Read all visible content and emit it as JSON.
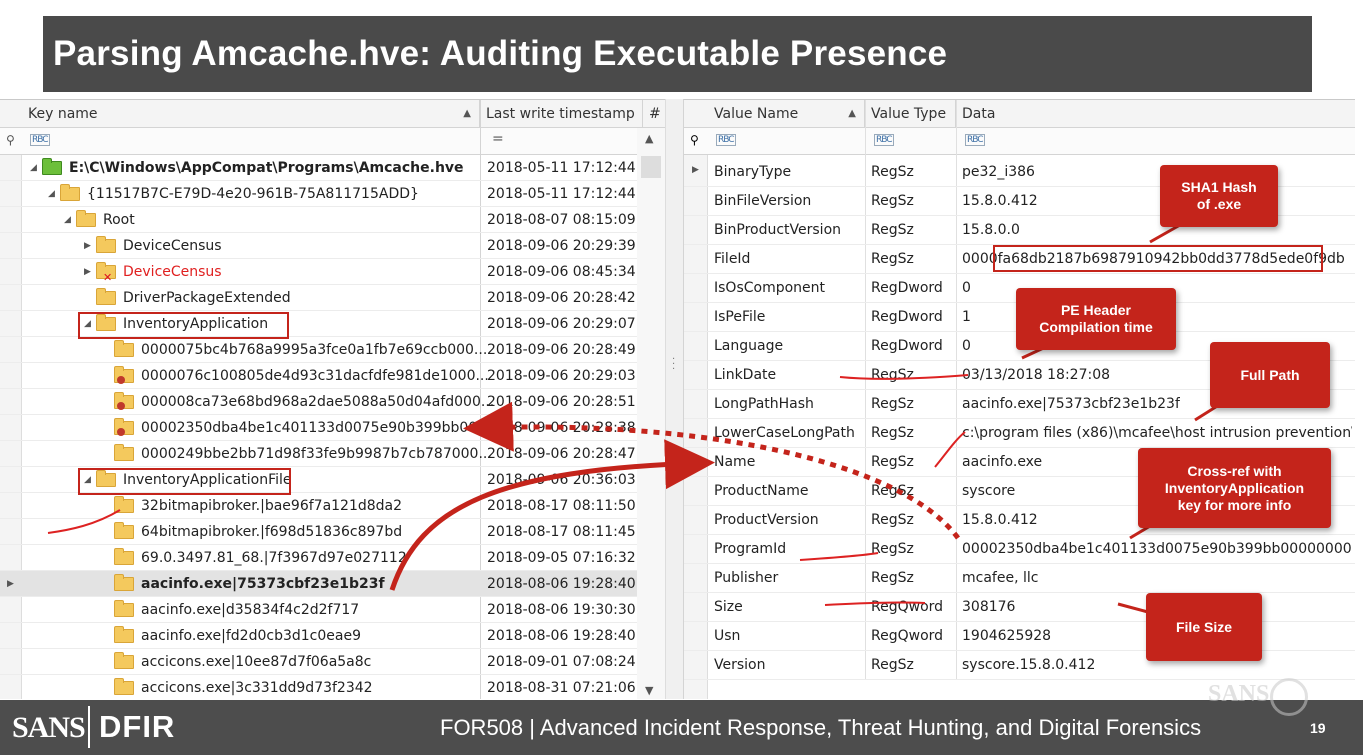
{
  "title": "Parsing Amcache.hve: Auditing Executable Presence",
  "left_pane": {
    "headers": {
      "key_name": "Key name",
      "last_write": "Last write timestamp",
      "hash_col": "#"
    },
    "filter": {
      "key_name": "RBC",
      "last_write": "="
    },
    "rows": [
      {
        "name": "E:\\C\\Windows\\AppCompat\\Programs\\Amcache.hve",
        "ts": "2018-05-11 17:12:44"
      },
      {
        "name": "{11517B7C-E79D-4e20-961B-75A811715ADD}",
        "ts": "2018-05-11 17:12:44"
      },
      {
        "name": "Root",
        "ts": "2018-08-07 08:15:09"
      },
      {
        "name": "DeviceCensus",
        "ts": "2018-09-06 20:29:39"
      },
      {
        "name": "DeviceCensus",
        "ts": "2018-09-06 08:45:34"
      },
      {
        "name": "DriverPackageExtended",
        "ts": "2018-09-06 20:28:42"
      },
      {
        "name": "InventoryApplication",
        "ts": "2018-09-06 20:29:07"
      },
      {
        "name": "0000075bc4b768a9995a3fce0a1fb7e69ccb000...",
        "ts": "2018-09-06 20:28:49"
      },
      {
        "name": "0000076c100805de4d93c31dacfdfe981de1000...",
        "ts": "2018-09-06 20:29:03"
      },
      {
        "name": "000008ca73e68bd968a2dae5088a50d04afd000...",
        "ts": "2018-09-06 20:28:51"
      },
      {
        "name": "00002350dba4be1c401133d0075e90b399bb000...",
        "ts": "2018-09-06 20:28:38"
      },
      {
        "name": "0000249bbe2bb71d98f33fe9b9987b7cb787000...",
        "ts": "2018-09-06 20:28:47"
      },
      {
        "name": "InventoryApplicationFile",
        "ts": "2018-09-06 20:36:03"
      },
      {
        "name": "32bitmapibroker.|bae96f7a121d8da2",
        "ts": "2018-08-17 08:11:50"
      },
      {
        "name": "64bitmapibroker.|f698d51836c897bd",
        "ts": "2018-08-17 08:11:45"
      },
      {
        "name": "69.0.3497.81_68.|7f3967d97e027112",
        "ts": "2018-09-05 07:16:32"
      },
      {
        "name": "aacinfo.exe|75373cbf23e1b23f",
        "ts": "2018-08-06 19:28:40"
      },
      {
        "name": "aacinfo.exe|d35834f4c2d2f717",
        "ts": "2018-08-06 19:30:30"
      },
      {
        "name": "aacinfo.exe|fd2d0cb3d1c0eae9",
        "ts": "2018-08-06 19:28:40"
      },
      {
        "name": "accicons.exe|10ee87d7f06a5a8c",
        "ts": "2018-09-01 07:08:24"
      },
      {
        "name": "accicons.exe|3c331dd9d73f2342",
        "ts": "2018-08-31 07:21:06"
      }
    ]
  },
  "right_pane": {
    "headers": {
      "value_name": "Value Name",
      "value_type": "Value Type",
      "data": "Data"
    },
    "filter": {
      "value_name": "RBC",
      "value_type": "RBC",
      "data": "RBC"
    },
    "rows": [
      {
        "name": "BinaryType",
        "type": "RegSz",
        "data": "pe32_i386"
      },
      {
        "name": "BinFileVersion",
        "type": "RegSz",
        "data": "15.8.0.412"
      },
      {
        "name": "BinProductVersion",
        "type": "RegSz",
        "data": "15.8.0.0"
      },
      {
        "name": "FileId",
        "type": "RegSz",
        "data": "0000fa68db2187b6987910942bb0dd3778d5ede0f9db"
      },
      {
        "name": "IsOsComponent",
        "type": "RegDword",
        "data": "0"
      },
      {
        "name": "IsPeFile",
        "type": "RegDword",
        "data": "1"
      },
      {
        "name": "Language",
        "type": "RegDword",
        "data": "0"
      },
      {
        "name": "LinkDate",
        "type": "RegSz",
        "data": "03/13/2018 18:27:08"
      },
      {
        "name": "LongPathHash",
        "type": "RegSz",
        "data": "aacinfo.exe|75373cbf23e1b23f"
      },
      {
        "name": "LowerCaseLongPath",
        "type": "RegSz",
        "data": "c:\\program files (x86)\\mcafee\\host intrusion prevention\\..."
      },
      {
        "name": "Name",
        "type": "RegSz",
        "data": "aacinfo.exe"
      },
      {
        "name": "ProductName",
        "type": "RegSz",
        "data": "syscore"
      },
      {
        "name": "ProductVersion",
        "type": "RegSz",
        "data": "15.8.0.412"
      },
      {
        "name": "ProgramId",
        "type": "RegSz",
        "data": "00002350dba4be1c401133d0075e90b399bb00000000"
      },
      {
        "name": "Publisher",
        "type": "RegSz",
        "data": "mcafee, llc"
      },
      {
        "name": "Size",
        "type": "RegQword",
        "data": "308176"
      },
      {
        "name": "Usn",
        "type": "RegQword",
        "data": "1904625928"
      },
      {
        "name": "Version",
        "type": "RegSz",
        "data": "syscore.15.8.0.412"
      }
    ]
  },
  "callouts": {
    "sha1": "SHA1 Hash\nof .exe",
    "pe_header": "PE Header\nCompilation time",
    "full_path": "Full Path",
    "cross_ref": "Cross-ref with\nInventoryApplication\nkey for more info",
    "file_size": "File Size"
  },
  "footer": {
    "logo_left": "SANS",
    "logo_right": "DFIR",
    "course": "FOR508  |  Advanced Incident Response, Threat Hunting, and Digital Forensics",
    "page": "19",
    "watermark": "SANS"
  },
  "colors": {
    "accent_red": "#c4241b",
    "title_bg": "#4a4a4a",
    "footer_bg": "#4d4d4d",
    "folder": "#f4c95d"
  }
}
